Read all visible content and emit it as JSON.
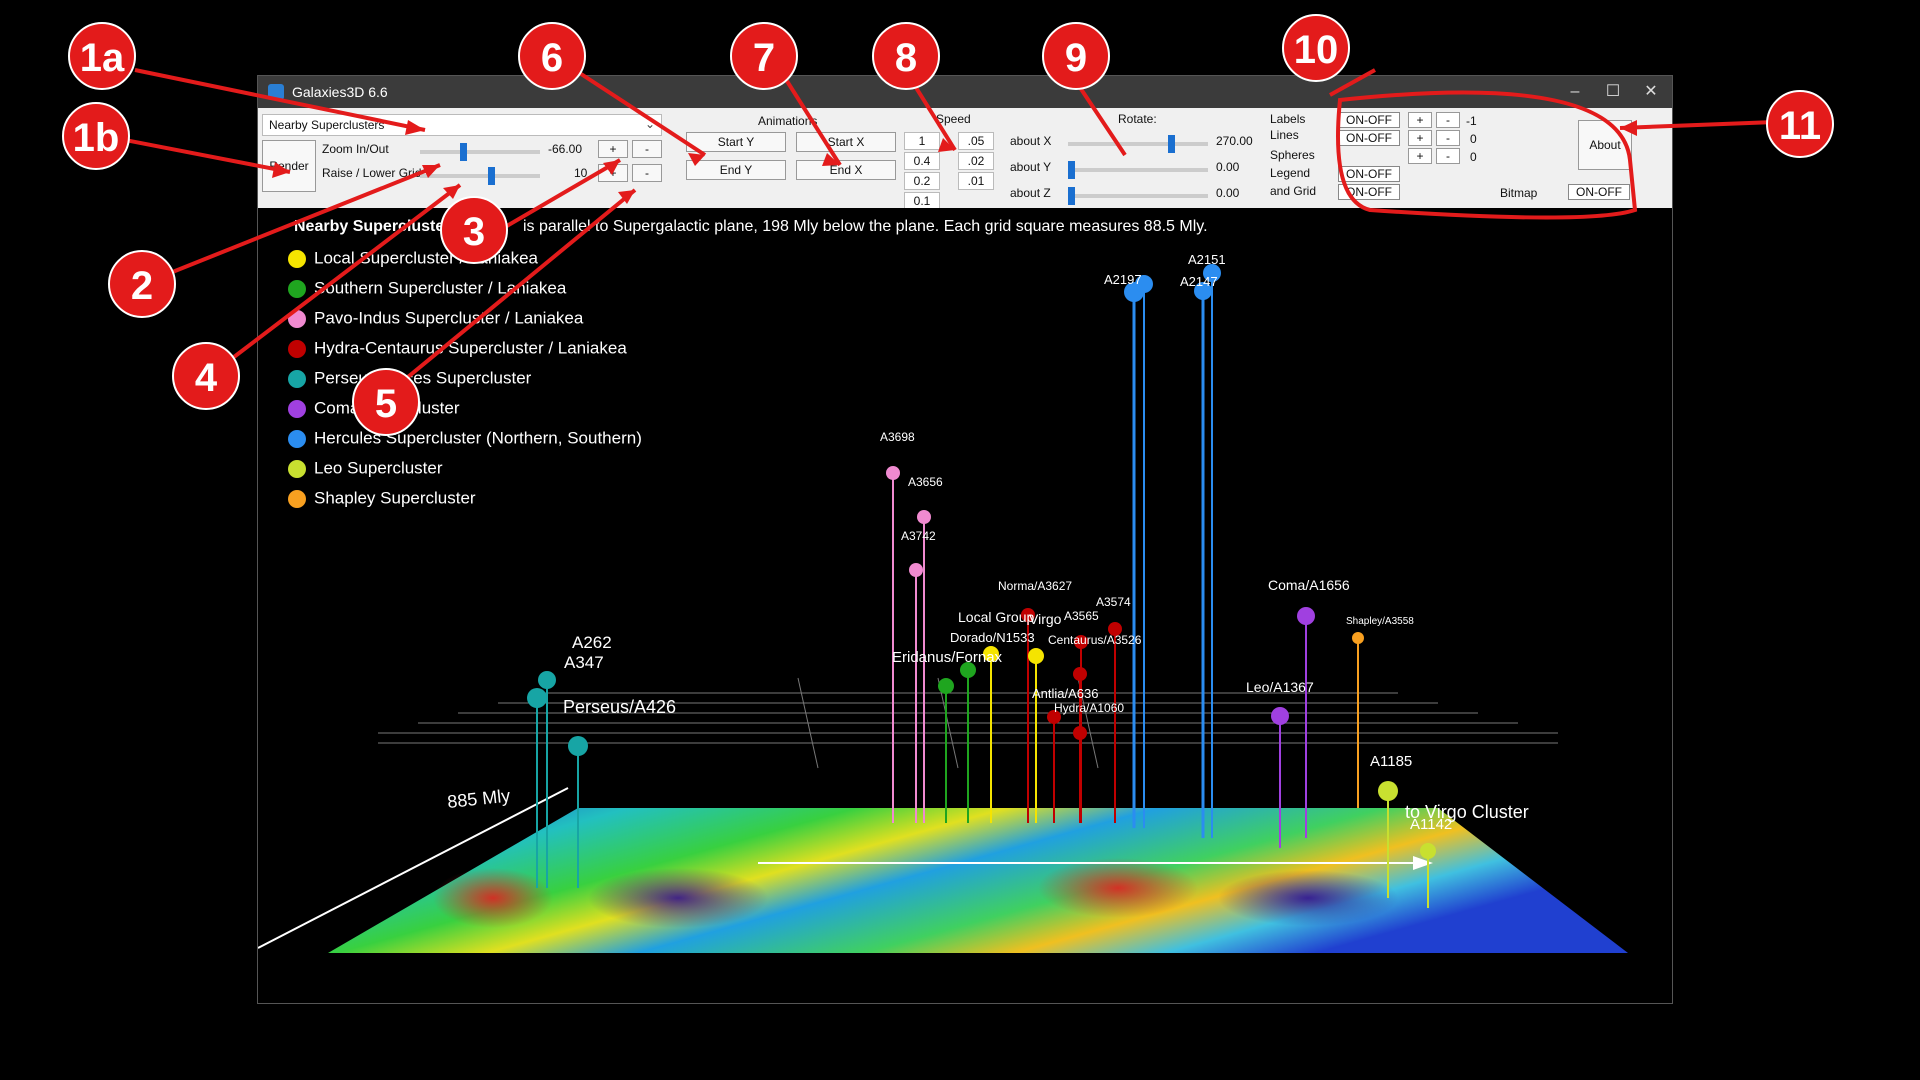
{
  "window": {
    "title": "Galaxies3D 6.6"
  },
  "toolbar": {
    "dataset_selected": "Nearby Superclusters",
    "render_label": "Render",
    "zoom": {
      "label": "Zoom In/Out",
      "value": "-66.00",
      "plus": "+",
      "minus": "-",
      "level": 0.35
    },
    "raise": {
      "label": "Raise / Lower Grid",
      "value": "10",
      "plus": "+",
      "minus": "-",
      "level": 0.6
    },
    "animations": {
      "label": "Animations",
      "start_y": "Start Y",
      "start_x": "Start X",
      "end_y": "End Y",
      "end_x": "End X"
    },
    "speed": {
      "label": "Speed",
      "col1": [
        "1",
        "0.4",
        "0.2",
        "0.1"
      ],
      "col2": [
        ".05",
        ".02",
        ".01"
      ]
    },
    "rotate": {
      "label": "Rotate:",
      "x": {
        "label": "about X",
        "value": "270.00",
        "level": 0.75
      },
      "y": {
        "label": "about Y",
        "value": "0.00",
        "level": 0.0
      },
      "z": {
        "label": "about Z",
        "value": "0.00",
        "level": 0.0
      }
    },
    "display": {
      "labels": {
        "label": "Labels",
        "toggle": "ON-OFF",
        "value": "-1"
      },
      "lines": {
        "label": "Lines",
        "toggle": "ON-OFF",
        "value": "0"
      },
      "spheres": {
        "label": "Spheres",
        "value": "0"
      },
      "legend": {
        "label": "Legend",
        "toggle": "ON-OFF"
      },
      "grid": {
        "label": "and Grid",
        "toggle": "ON-OFF"
      },
      "plus": "+",
      "minus": "-"
    },
    "bitmap": {
      "label": "Bitmap",
      "toggle": "ON-OFF"
    },
    "about_label": "About"
  },
  "viewport": {
    "title": "Nearby Superclusters",
    "caption": "is parallel to Supergalactic plane, 198 Mly below the plane.  Each grid square measures 88.5 Mly.",
    "legend": [
      {
        "label": "Local Supercluster / Laniakea",
        "color": "#f5e400"
      },
      {
        "label": "Southern Supercluster / Laniakea",
        "color": "#1fa51f"
      },
      {
        "label": "Pavo-Indus Supercluster / Laniakea",
        "color": "#f08ad0"
      },
      {
        "label": "Hydra-Centaurus Supercluster / Laniakea",
        "color": "#c00000"
      },
      {
        "label": "Perseus Pisces Supercluster",
        "color": "#17a5a5"
      },
      {
        "label": "Coma Supercluster",
        "color": "#a040e0"
      },
      {
        "label": "Hercules Supercluster (Northern, Southern)",
        "color": "#2b8df0"
      },
      {
        "label": "Leo Supercluster",
        "color": "#c8e030"
      },
      {
        "label": "Shapley Supercluster",
        "color": "#f8a020"
      }
    ],
    "distance_label": "885 Mly",
    "direction_label": "to Virgo Cluster",
    "labels": {
      "A3698": "A3698",
      "A3656": "A3656",
      "A3742": "A3742",
      "Norma": "Norma/A3627",
      "A3574": "A3574",
      "A3565": "A3565",
      "LocalGroup": "Local Group",
      "Virgo": "Virgo",
      "Dorado": "Dorado/N1533",
      "Centaurus": "Centaurus/A3526",
      "A262": "A262",
      "A347": "A347",
      "Eridanus": "Eridanus/Fornax",
      "Perseus": "Perseus/A426",
      "Antlia": "Antlia/A636",
      "Hydra": "Hydra/A1060",
      "Coma": "Coma/A1656",
      "Shapley": "Shapley/A3558",
      "Leo": "Leo/A1367",
      "A1185": "A1185",
      "A1142": "A1142",
      "A2197": "A2197",
      "A2151": "A2151",
      "A2147": "A2147"
    }
  },
  "annotations": [
    "1a",
    "1b",
    "2",
    "3",
    "4",
    "5",
    "6",
    "7",
    "8",
    "9",
    "10",
    "11"
  ],
  "colors": {
    "annotation": "#e31b1b",
    "slider_thumb": "#1a6fd0"
  }
}
